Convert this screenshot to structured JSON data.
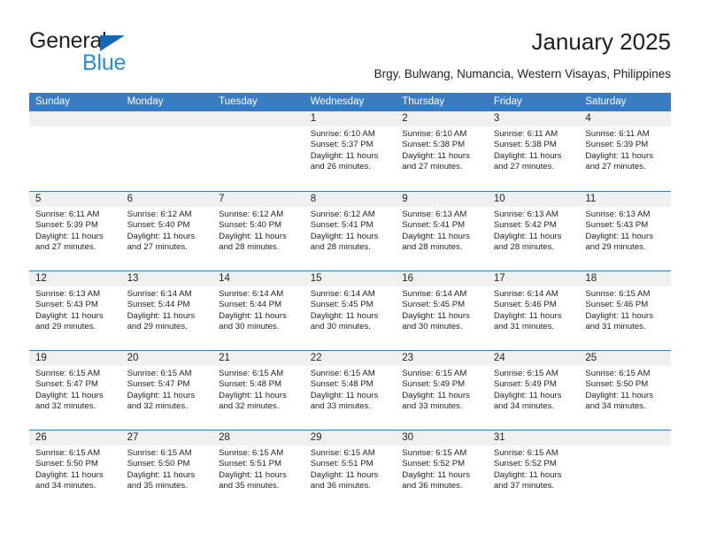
{
  "brand": {
    "name_part1": "General",
    "name_part2": "Blue",
    "accent_color": "#2e8bd4",
    "triangle_color": "#1668b3",
    "triangle_icon": "triangle-logo-icon"
  },
  "header": {
    "title": "January 2025",
    "subtitle": "Brgy. Bulwang, Numancia, Western Visayas, Philippines"
  },
  "calendar": {
    "header_bg": "#3a7cc0",
    "day_band_bg": "#f0f0f0",
    "weekdays": [
      "Sunday",
      "Monday",
      "Tuesday",
      "Wednesday",
      "Thursday",
      "Friday",
      "Saturday"
    ],
    "weeks": [
      [
        {
          "blank": true
        },
        {
          "blank": true
        },
        {
          "blank": true
        },
        {
          "day": "1",
          "sunrise": "Sunrise: 6:10 AM",
          "sunset": "Sunset: 5:37 PM",
          "daylight": "Daylight: 11 hours and 26 minutes."
        },
        {
          "day": "2",
          "sunrise": "Sunrise: 6:10 AM",
          "sunset": "Sunset: 5:38 PM",
          "daylight": "Daylight: 11 hours and 27 minutes."
        },
        {
          "day": "3",
          "sunrise": "Sunrise: 6:11 AM",
          "sunset": "Sunset: 5:38 PM",
          "daylight": "Daylight: 11 hours and 27 minutes."
        },
        {
          "day": "4",
          "sunrise": "Sunrise: 6:11 AM",
          "sunset": "Sunset: 5:39 PM",
          "daylight": "Daylight: 11 hours and 27 minutes."
        }
      ],
      [
        {
          "day": "5",
          "sunrise": "Sunrise: 6:11 AM",
          "sunset": "Sunset: 5:39 PM",
          "daylight": "Daylight: 11 hours and 27 minutes."
        },
        {
          "day": "6",
          "sunrise": "Sunrise: 6:12 AM",
          "sunset": "Sunset: 5:40 PM",
          "daylight": "Daylight: 11 hours and 27 minutes."
        },
        {
          "day": "7",
          "sunrise": "Sunrise: 6:12 AM",
          "sunset": "Sunset: 5:40 PM",
          "daylight": "Daylight: 11 hours and 28 minutes."
        },
        {
          "day": "8",
          "sunrise": "Sunrise: 6:12 AM",
          "sunset": "Sunset: 5:41 PM",
          "daylight": "Daylight: 11 hours and 28 minutes."
        },
        {
          "day": "9",
          "sunrise": "Sunrise: 6:13 AM",
          "sunset": "Sunset: 5:41 PM",
          "daylight": "Daylight: 11 hours and 28 minutes."
        },
        {
          "day": "10",
          "sunrise": "Sunrise: 6:13 AM",
          "sunset": "Sunset: 5:42 PM",
          "daylight": "Daylight: 11 hours and 28 minutes."
        },
        {
          "day": "11",
          "sunrise": "Sunrise: 6:13 AM",
          "sunset": "Sunset: 5:43 PM",
          "daylight": "Daylight: 11 hours and 29 minutes."
        }
      ],
      [
        {
          "day": "12",
          "sunrise": "Sunrise: 6:13 AM",
          "sunset": "Sunset: 5:43 PM",
          "daylight": "Daylight: 11 hours and 29 minutes."
        },
        {
          "day": "13",
          "sunrise": "Sunrise: 6:14 AM",
          "sunset": "Sunset: 5:44 PM",
          "daylight": "Daylight: 11 hours and 29 minutes."
        },
        {
          "day": "14",
          "sunrise": "Sunrise: 6:14 AM",
          "sunset": "Sunset: 5:44 PM",
          "daylight": "Daylight: 11 hours and 30 minutes."
        },
        {
          "day": "15",
          "sunrise": "Sunrise: 6:14 AM",
          "sunset": "Sunset: 5:45 PM",
          "daylight": "Daylight: 11 hours and 30 minutes."
        },
        {
          "day": "16",
          "sunrise": "Sunrise: 6:14 AM",
          "sunset": "Sunset: 5:45 PM",
          "daylight": "Daylight: 11 hours and 30 minutes."
        },
        {
          "day": "17",
          "sunrise": "Sunrise: 6:14 AM",
          "sunset": "Sunset: 5:46 PM",
          "daylight": "Daylight: 11 hours and 31 minutes."
        },
        {
          "day": "18",
          "sunrise": "Sunrise: 6:15 AM",
          "sunset": "Sunset: 5:46 PM",
          "daylight": "Daylight: 11 hours and 31 minutes."
        }
      ],
      [
        {
          "day": "19",
          "sunrise": "Sunrise: 6:15 AM",
          "sunset": "Sunset: 5:47 PM",
          "daylight": "Daylight: 11 hours and 32 minutes."
        },
        {
          "day": "20",
          "sunrise": "Sunrise: 6:15 AM",
          "sunset": "Sunset: 5:47 PM",
          "daylight": "Daylight: 11 hours and 32 minutes."
        },
        {
          "day": "21",
          "sunrise": "Sunrise: 6:15 AM",
          "sunset": "Sunset: 5:48 PM",
          "daylight": "Daylight: 11 hours and 32 minutes."
        },
        {
          "day": "22",
          "sunrise": "Sunrise: 6:15 AM",
          "sunset": "Sunset: 5:48 PM",
          "daylight": "Daylight: 11 hours and 33 minutes."
        },
        {
          "day": "23",
          "sunrise": "Sunrise: 6:15 AM",
          "sunset": "Sunset: 5:49 PM",
          "daylight": "Daylight: 11 hours and 33 minutes."
        },
        {
          "day": "24",
          "sunrise": "Sunrise: 6:15 AM",
          "sunset": "Sunset: 5:49 PM",
          "daylight": "Daylight: 11 hours and 34 minutes."
        },
        {
          "day": "25",
          "sunrise": "Sunrise: 6:15 AM",
          "sunset": "Sunset: 5:50 PM",
          "daylight": "Daylight: 11 hours and 34 minutes."
        }
      ],
      [
        {
          "day": "26",
          "sunrise": "Sunrise: 6:15 AM",
          "sunset": "Sunset: 5:50 PM",
          "daylight": "Daylight: 11 hours and 34 minutes."
        },
        {
          "day": "27",
          "sunrise": "Sunrise: 6:15 AM",
          "sunset": "Sunset: 5:50 PM",
          "daylight": "Daylight: 11 hours and 35 minutes."
        },
        {
          "day": "28",
          "sunrise": "Sunrise: 6:15 AM",
          "sunset": "Sunset: 5:51 PM",
          "daylight": "Daylight: 11 hours and 35 minutes."
        },
        {
          "day": "29",
          "sunrise": "Sunrise: 6:15 AM",
          "sunset": "Sunset: 5:51 PM",
          "daylight": "Daylight: 11 hours and 36 minutes."
        },
        {
          "day": "30",
          "sunrise": "Sunrise: 6:15 AM",
          "sunset": "Sunset: 5:52 PM",
          "daylight": "Daylight: 11 hours and 36 minutes."
        },
        {
          "day": "31",
          "sunrise": "Sunrise: 6:15 AM",
          "sunset": "Sunset: 5:52 PM",
          "daylight": "Daylight: 11 hours and 37 minutes."
        },
        {
          "blank": true
        }
      ]
    ]
  }
}
